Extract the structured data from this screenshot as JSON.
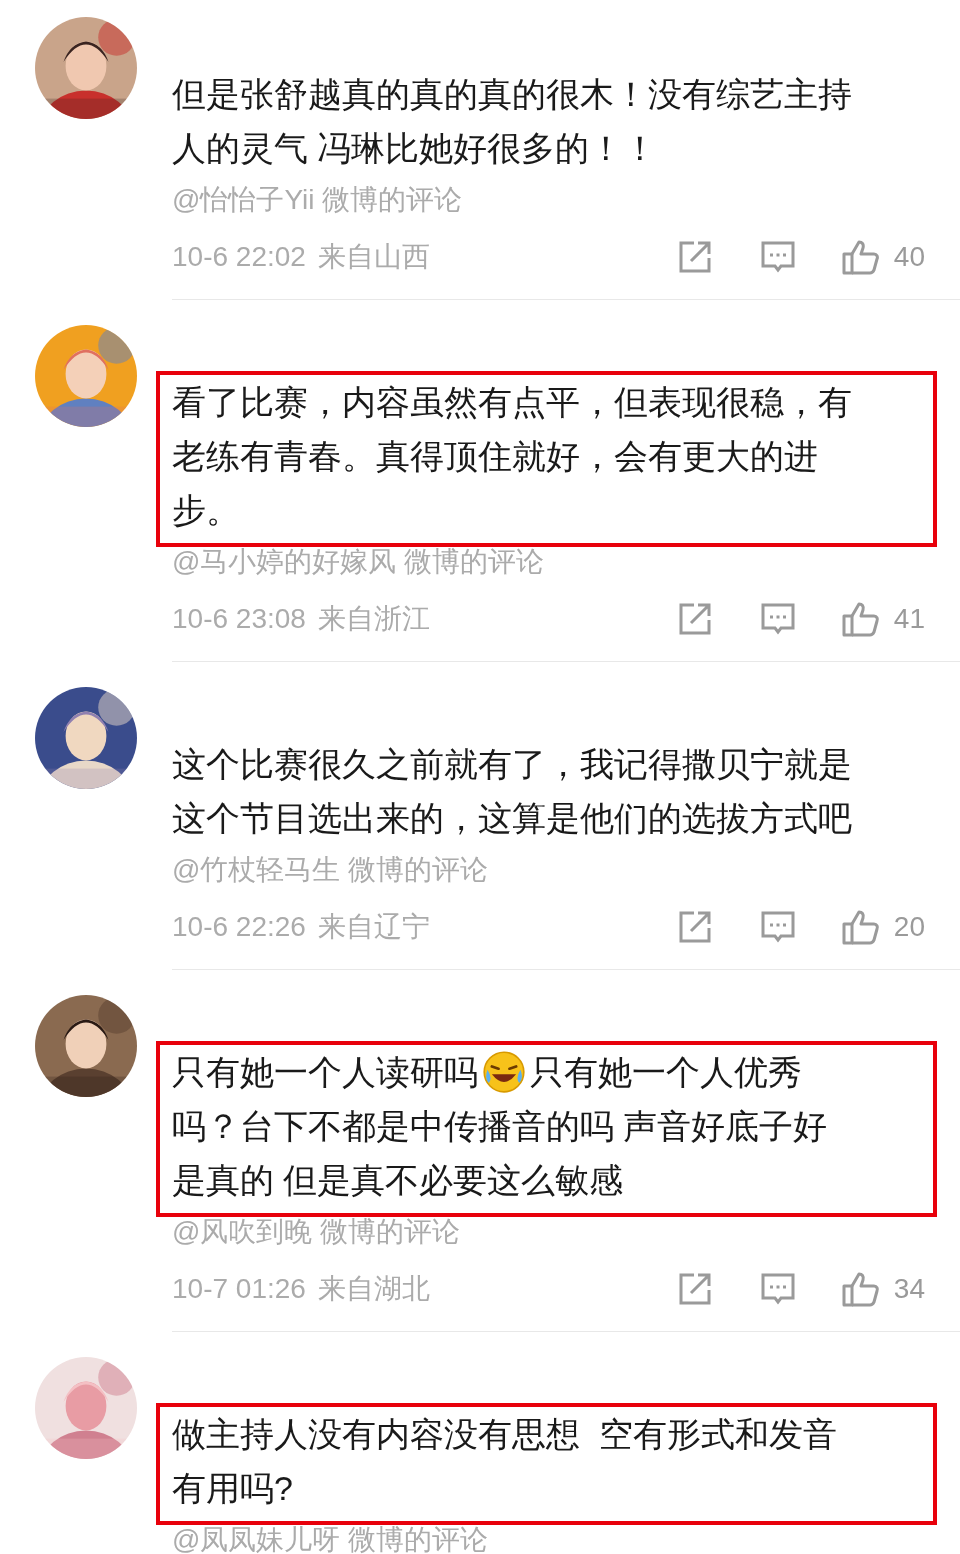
{
  "comments": [
    {
      "highlighted": false,
      "lines": [
        [
          {
            "kind": "text",
            "text": "但是张舒越真的真的真的很木！没有综艺主持"
          }
        ],
        [
          {
            "kind": "text",
            "text": "人的灵气 冯琳比她好很多的！！"
          }
        ]
      ],
      "source": "@怡怡子Yii 微博的评论",
      "time": "10-6 22:02",
      "location": "来自山西",
      "likes": "40"
    },
    {
      "highlighted": true,
      "lines": [
        [
          {
            "kind": "text",
            "text": "看了比赛，内容虽然有点平，但表现很稳，有"
          }
        ],
        [
          {
            "kind": "text",
            "text": "老练有青春。真得顶住就好，会有更大的进"
          }
        ],
        [
          {
            "kind": "text",
            "text": "步。"
          }
        ]
      ],
      "source": "@马小婷的好嫁风 微博的评论",
      "time": "10-6 23:08",
      "location": "来自浙江",
      "likes": "41"
    },
    {
      "highlighted": false,
      "lines": [
        [
          {
            "kind": "text",
            "text": "这个比赛很久之前就有了，我记得撒贝宁就是"
          }
        ],
        [
          {
            "kind": "text",
            "text": "这个节目选出来的，这算是他们的选拔方式吧"
          }
        ]
      ],
      "source": "@竹杖轻马生 微博的评论",
      "time": "10-6 22:26",
      "location": "来自辽宁",
      "likes": "20"
    },
    {
      "highlighted": true,
      "lines": [
        [
          {
            "kind": "text",
            "text": "只有她一个人读研吗"
          },
          {
            "kind": "emoji"
          },
          {
            "kind": "text",
            "text": "只有她一个人优秀"
          }
        ],
        [
          {
            "kind": "text",
            "text": "吗？台下不都是中传播音的吗 声音好底子好"
          }
        ],
        [
          {
            "kind": "text",
            "text": "是真的 但是真不必要这么敏感"
          }
        ]
      ],
      "source": "@风吹到晚 微博的评论",
      "time": "10-7 01:26",
      "location": "来自湖北",
      "likes": "34"
    },
    {
      "highlighted": true,
      "lines": [
        [
          {
            "kind": "text",
            "text": "做主持人没有内容没有思想  空有形式和发音"
          }
        ],
        [
          {
            "kind": "text",
            "text": "有用吗?"
          }
        ]
      ],
      "source": "@凤凤妹儿呀 微博的评论"
    }
  ]
}
